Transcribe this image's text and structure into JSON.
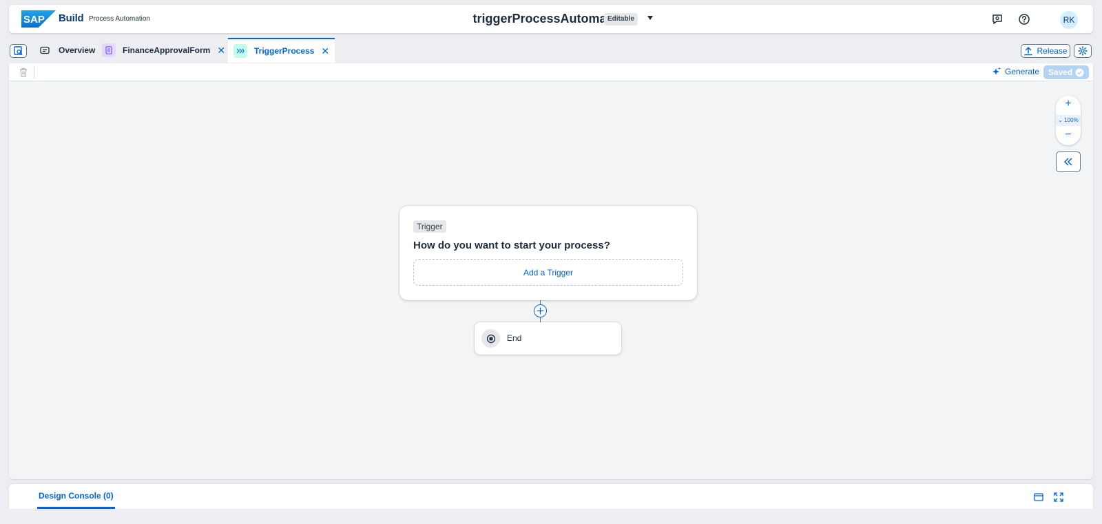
{
  "shell": {
    "logo_text": "SAP",
    "brand": "Build",
    "product": "Process Automation",
    "title": "triggerProcessAutomation",
    "mode_badge": "Editable",
    "avatar_initials": "RK",
    "icons": [
      "feedback-icon",
      "help-icon"
    ]
  },
  "tabs": {
    "items": [
      {
        "label": "Overview",
        "icon": "overview-icon",
        "closable": false,
        "active": false
      },
      {
        "label": "FinanceApprovalForm",
        "icon": "form-icon",
        "closable": true,
        "active": false
      },
      {
        "label": "TriggerProcess",
        "icon": "process-icon",
        "closable": true,
        "active": true
      }
    ],
    "close_glyph": "✕",
    "release_label": "Release"
  },
  "toolbar": {
    "generate_label": "Generate",
    "saved_label": "Saved"
  },
  "zoom": {
    "plus": "+",
    "level": "100%",
    "minus": "−"
  },
  "canvas": {
    "trigger_tag": "Trigger",
    "trigger_question": "How do you want to start your process?",
    "add_trigger_label": "Add a Trigger",
    "end_label": "End"
  },
  "console": {
    "tab_label": "Design Console (0)"
  },
  "colors": {
    "accent": "#0064d9",
    "brand_dark": "#0a3c74",
    "canvas_bg": "#f3f4f6",
    "saved_bg": "#b3d3f5"
  }
}
